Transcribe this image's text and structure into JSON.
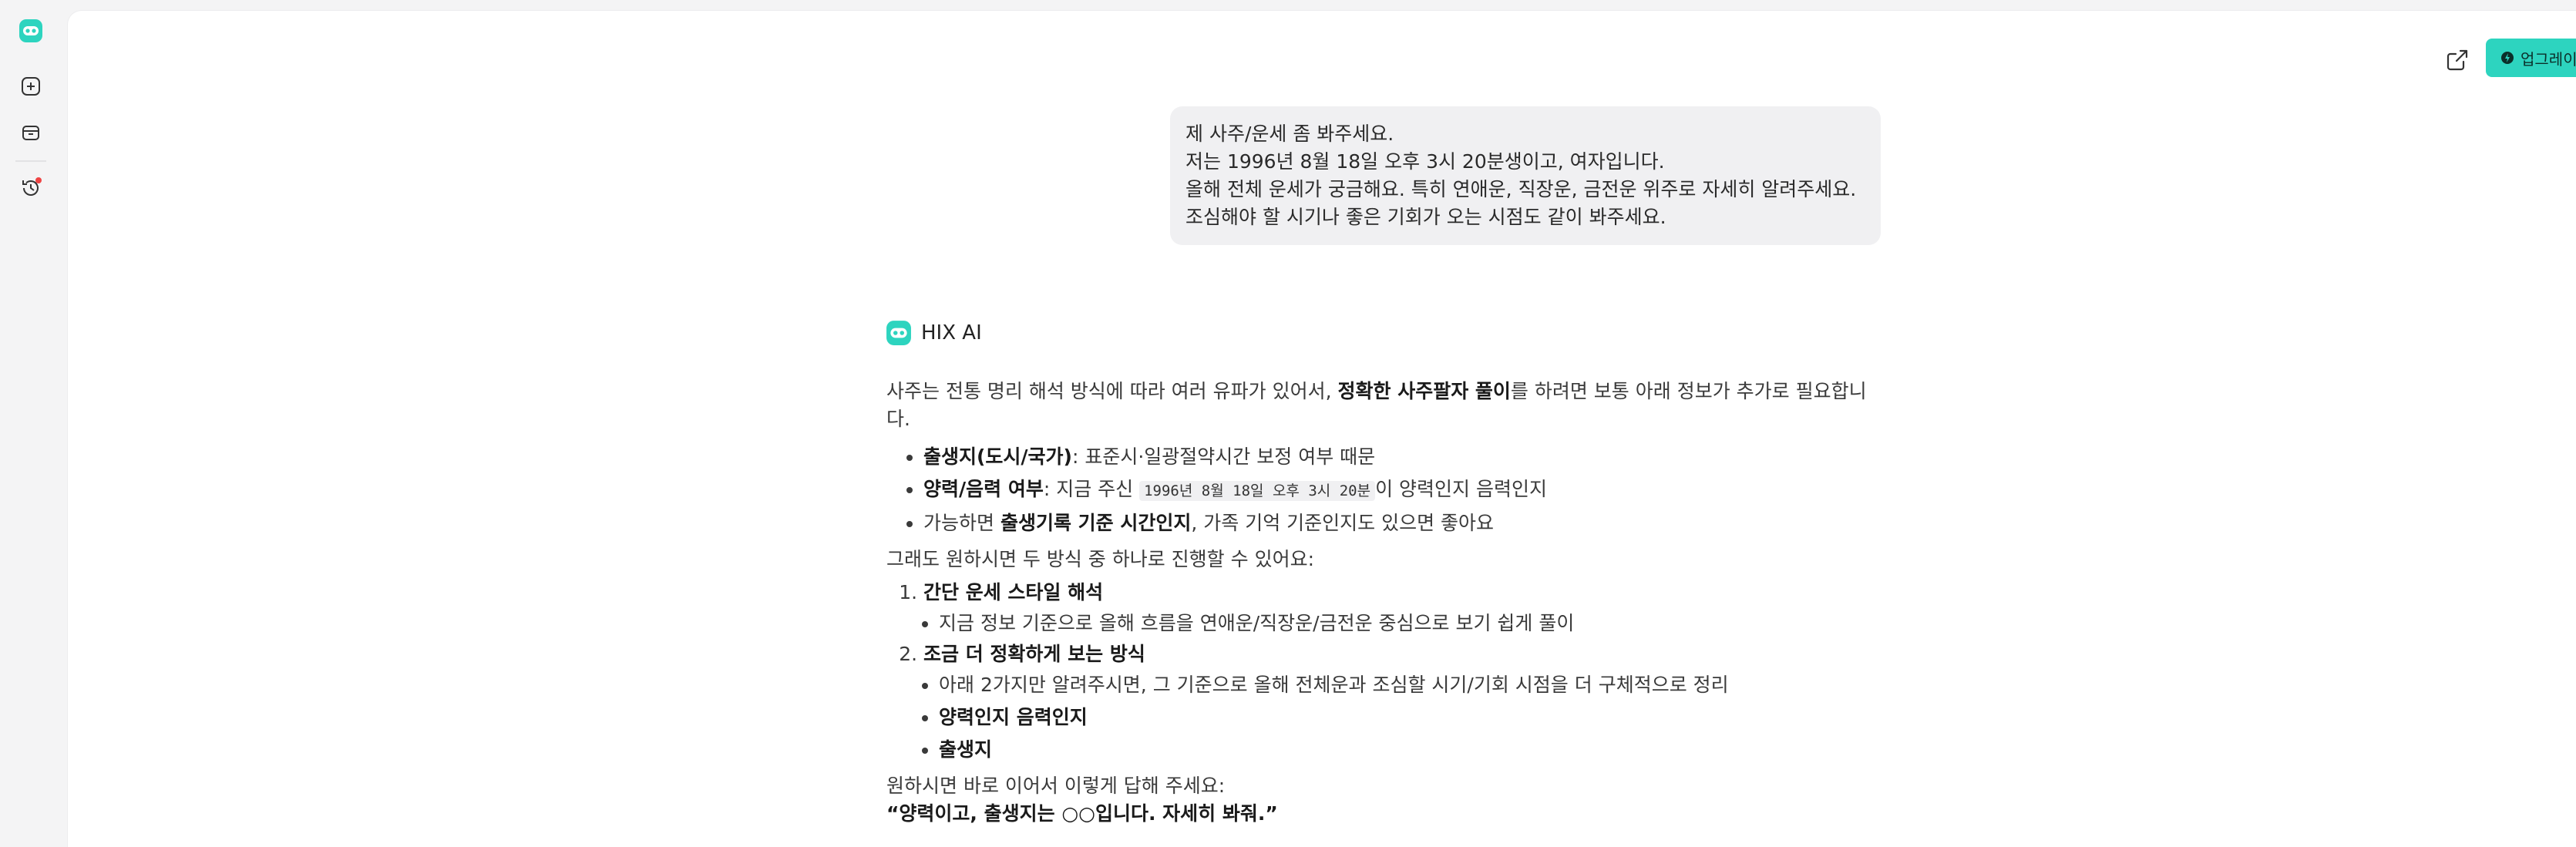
{
  "sidebar": {
    "logo_icon": "hix-logo-icon",
    "items": [
      {
        "name": "new-chat",
        "icon": "plus-square-icon"
      },
      {
        "name": "library",
        "icon": "archive-icon"
      },
      {
        "name": "history",
        "icon": "history-icon",
        "has_notification": true
      }
    ]
  },
  "header": {
    "share_icon": "share-icon",
    "upgrade_label": "업그레이드",
    "upgrade_icon": "bolt-icon"
  },
  "colors": {
    "accent": "#2dd4bf",
    "notification": "#ef4444",
    "bubble_bg": "#f0f0f2"
  },
  "user_message": {
    "lines": [
      "제 사주/운세 좀 봐주세요.",
      "저는 1996년 8월 18일 오후 3시 20분생이고, 여자입니다.",
      "올해 전체 운세가 궁금해요. 특히 연애운, 직장운, 금전운 위주로 자세히 알려주세요.",
      "조심해야 할 시기나 좋은 기회가 오는 시점도 같이 봐주세요."
    ]
  },
  "assistant": {
    "name": "HIX AI",
    "intro_before": "사주는 전통 명리 해석 방식에 따라 여러 유파가 있어서, ",
    "intro_bold": "정확한 사주팔자 풀이",
    "intro_after": "를 하려면 보통 아래 정보가 추가로 필요합니다.",
    "bullets": [
      {
        "bold": "출생지(도시/국가)",
        "text": ": 표준시·일광절약시간 보정 여부 때문"
      },
      {
        "bold": "양력/음력 여부",
        "text_before": ": 지금 주신 ",
        "code": "1996년 8월 18일 오후 3시 20분",
        "text_after": "이 양력인지 음력인지"
      },
      {
        "text_before": "가능하면 ",
        "bold": "출생기록 기준 시간인지",
        "text_after": ", 가족 기억 기준인지도 있으면 좋아요"
      }
    ],
    "choice_intro": "그래도 원하시면 두 방식 중 하나로 진행할 수 있어요:",
    "options": [
      {
        "title": "간단 운세 스타일 해석",
        "subitems": [
          "지금 정보 기준으로 올해 흐름을 연애운/직장운/금전운 중심으로 보기 쉽게 풀이"
        ]
      },
      {
        "title": "조금 더 정확하게 보는 방식",
        "subitems": [
          "아래 2가지만 알려주시면, 그 기준으로 올해 전체운과 조심할 시기/기회 시점을 더 구체적으로 정리"
        ],
        "bold_subitems": [
          "양력인지 음력인지",
          "출생지"
        ]
      }
    ],
    "closing": "원하시면 바로 이어서 이렇게 답해 주세요:",
    "quote": "“양력이고, 출생지는 ○○입니다. 자세히 봐줘.”"
  }
}
